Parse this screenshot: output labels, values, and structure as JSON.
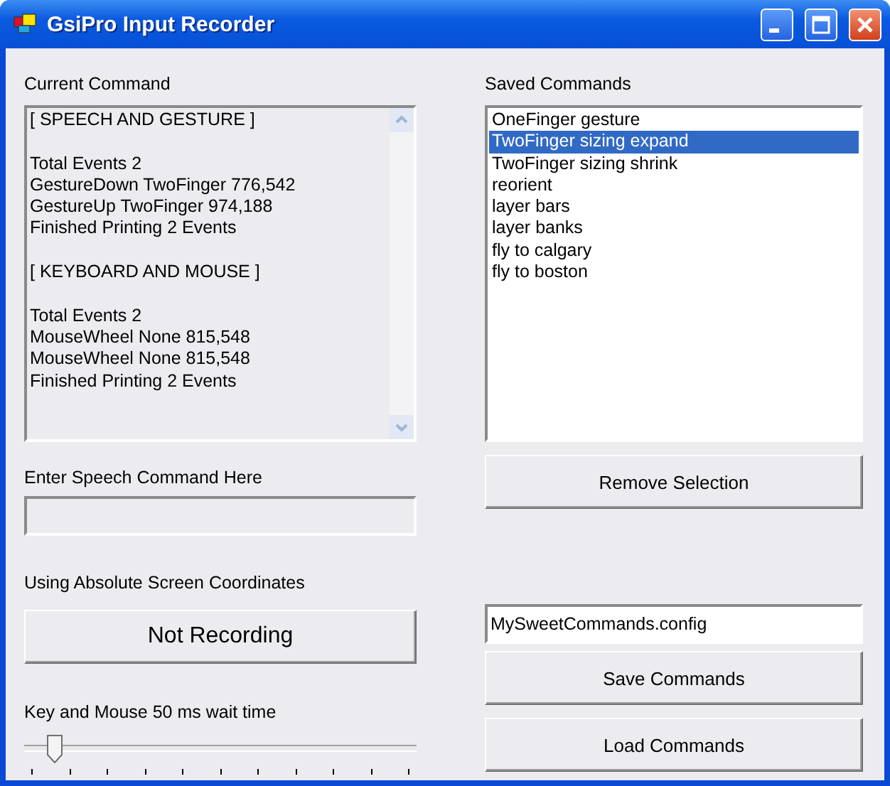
{
  "window": {
    "title": "GsiPro Input Recorder"
  },
  "current_command": {
    "label": "Current Command",
    "sections": [
      {
        "heading": "[ SPEECH AND GESTURE ]",
        "lines": [
          "Total Events 2",
          "GestureDown TwoFinger 776,542",
          "GestureUp TwoFinger 974,188",
          "Finished Printing 2 Events"
        ]
      },
      {
        "heading": "[ KEYBOARD AND MOUSE ]",
        "lines": [
          "Total Events 2",
          "MouseWheel None 815,548",
          "MouseWheel None 815,548",
          "Finished Printing 2 Events"
        ]
      }
    ]
  },
  "speech": {
    "label": "Enter Speech Command Here",
    "disabled": true
  },
  "coordinates_label": "Using Absolute Screen Coordinates",
  "record_button": "Not Recording",
  "wait_slider": {
    "label": "Key and Mouse 50 ms wait time",
    "level": 0.06
  },
  "saved_commands": {
    "label": "Saved Commands",
    "items": [
      {
        "label": "OneFinger gesture",
        "selected": false
      },
      {
        "label": "TwoFinger sizing expand",
        "selected": true
      },
      {
        "label": "TwoFinger sizing shrink",
        "selected": false
      },
      {
        "label": "reorient",
        "selected": false
      },
      {
        "label": "layer bars",
        "selected": false
      },
      {
        "label": "layer banks",
        "selected": false
      },
      {
        "label": "fly to calgary",
        "selected": false
      },
      {
        "label": "fly to boston",
        "selected": false
      }
    ]
  },
  "remove_button": "Remove Selection",
  "file_field": {
    "value": "MySweetCommands.config"
  },
  "buttons": [
    "Save Commands",
    "Load Commands"
  ]
}
